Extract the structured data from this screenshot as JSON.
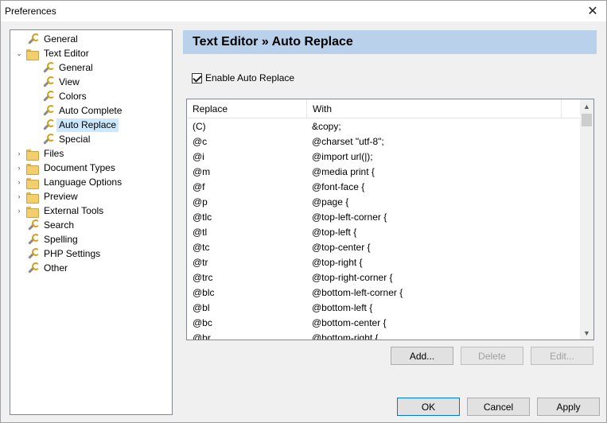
{
  "window": {
    "title": "Preferences"
  },
  "tree": {
    "items": [
      {
        "label": "General",
        "icon": "wrench-icon",
        "level": 1,
        "arrow": ""
      },
      {
        "label": "Text Editor",
        "icon": "folder-icon",
        "level": 1,
        "arrow": "expanded"
      },
      {
        "label": "General",
        "icon": "wrench-icon",
        "level": 2,
        "arrow": ""
      },
      {
        "label": "View",
        "icon": "wrench-icon",
        "level": 2,
        "arrow": ""
      },
      {
        "label": "Colors",
        "icon": "wrench-icon",
        "level": 2,
        "arrow": ""
      },
      {
        "label": "Auto Complete",
        "icon": "wrench-icon",
        "level": 2,
        "arrow": ""
      },
      {
        "label": "Auto Replace",
        "icon": "wrench-icon",
        "level": 2,
        "arrow": "",
        "selected": true
      },
      {
        "label": "Special",
        "icon": "wrench-icon",
        "level": 2,
        "arrow": ""
      },
      {
        "label": "Files",
        "icon": "folder-icon",
        "level": 1,
        "arrow": "collapsed"
      },
      {
        "label": "Document Types",
        "icon": "folder-icon",
        "level": 1,
        "arrow": "collapsed"
      },
      {
        "label": "Language Options",
        "icon": "folder-icon",
        "level": 1,
        "arrow": "collapsed"
      },
      {
        "label": "Preview",
        "icon": "folder-icon",
        "level": 1,
        "arrow": "collapsed"
      },
      {
        "label": "External Tools",
        "icon": "folder-icon",
        "level": 1,
        "arrow": "collapsed"
      },
      {
        "label": "Search",
        "icon": "wrench-icon",
        "level": 1,
        "arrow": ""
      },
      {
        "label": "Spelling",
        "icon": "wrench-icon",
        "level": 1,
        "arrow": ""
      },
      {
        "label": "PHP Settings",
        "icon": "wrench-icon",
        "level": 1,
        "arrow": ""
      },
      {
        "label": "Other",
        "icon": "wrench-icon",
        "level": 1,
        "arrow": ""
      }
    ]
  },
  "panel": {
    "title": "Text Editor » Auto Replace",
    "enable_label": "Enable Auto Replace",
    "enable_checked": true
  },
  "table": {
    "columns": [
      "Replace",
      "With"
    ],
    "rows": [
      [
        "(C)",
        "&copy;"
      ],
      [
        "@c",
        "@charset \"utf-8\";"
      ],
      [
        "@i",
        "@import url(|);"
      ],
      [
        "@m",
        "@media print {"
      ],
      [
        "@f",
        "@font-face {"
      ],
      [
        "@p",
        "@page {"
      ],
      [
        "@tlc",
        "@top-left-corner {"
      ],
      [
        "@tl",
        "@top-left {"
      ],
      [
        "@tc",
        "@top-center {"
      ],
      [
        "@tr",
        "@top-right {"
      ],
      [
        "@trc",
        "@top-right-corner {"
      ],
      [
        "@blc",
        "@bottom-left-corner {"
      ],
      [
        "@bl",
        "@bottom-left {"
      ],
      [
        "@bc",
        "@bottom-center {"
      ],
      [
        "@br",
        "@bottom-right {"
      ]
    ]
  },
  "buttons": {
    "add": "Add...",
    "delete": "Delete",
    "edit": "Edit...",
    "ok": "OK",
    "cancel": "Cancel",
    "apply": "Apply"
  },
  "icons": {
    "close": "✕",
    "up": "▲",
    "down": "▼",
    "expanded": "⌄",
    "collapsed": "›"
  },
  "colors": {
    "banner": "#b9d1ea",
    "selection": "#cce8ff"
  }
}
